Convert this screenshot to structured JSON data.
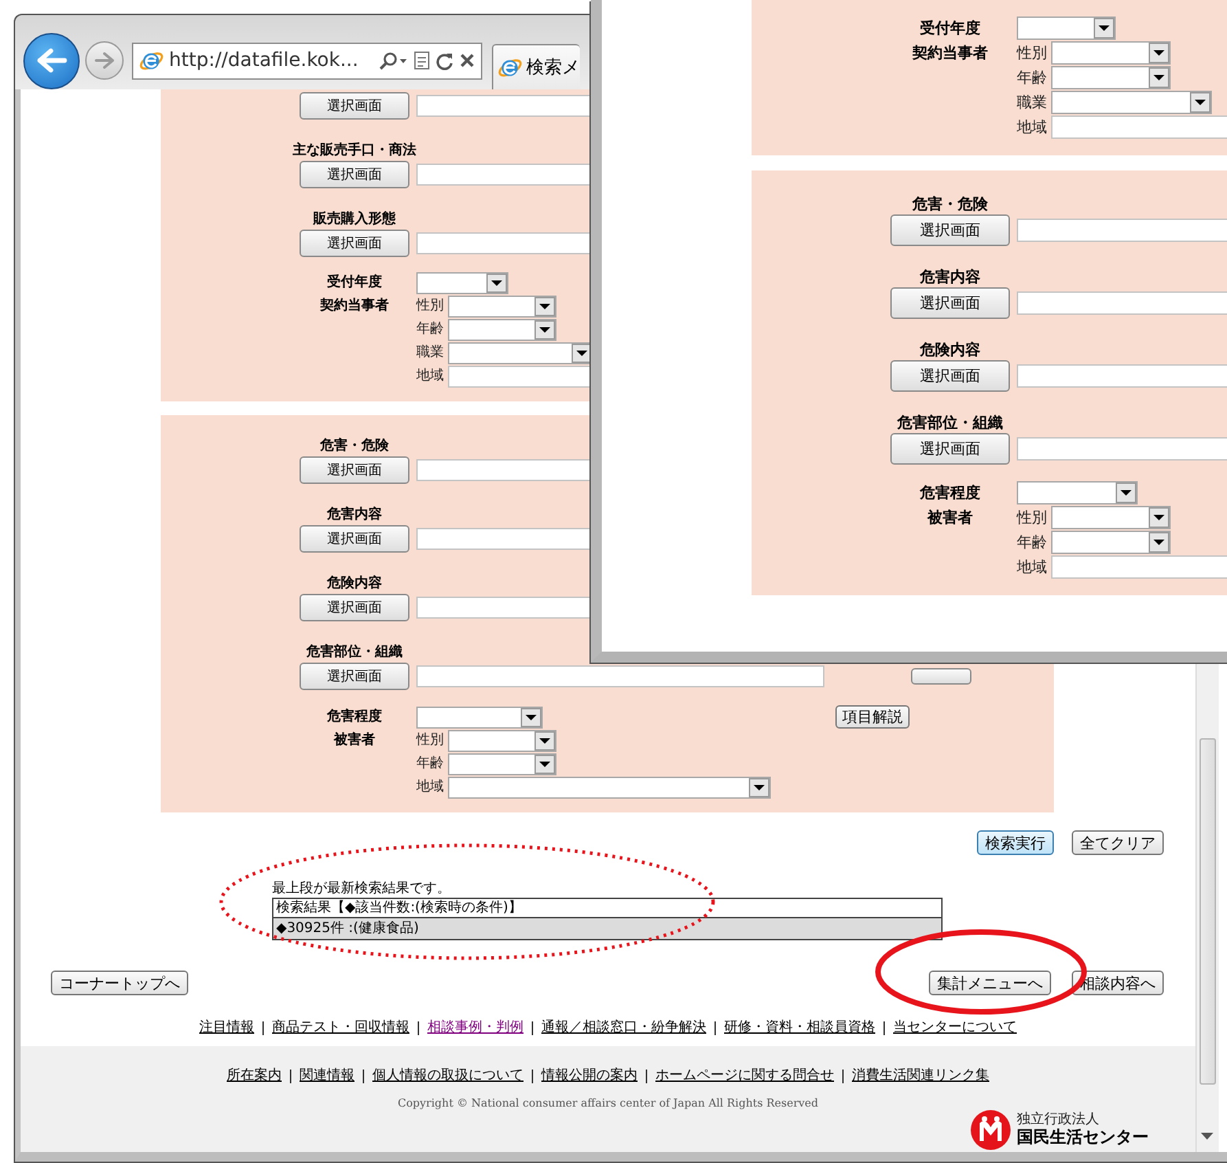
{
  "browser": {
    "address": "http://datafile.kok...",
    "tab_title": "検索メ"
  },
  "main_panels": [
    {
      "rows": [
        {
          "kind": "picker",
          "button": "選択画面"
        },
        {
          "kind": "picker",
          "label": "主な販売手口・商法",
          "button": "選択画面"
        },
        {
          "kind": "picker",
          "label": "販売購入形態",
          "button": "選択画面"
        },
        {
          "kind": "year",
          "label": "受付年度"
        },
        {
          "kind": "person",
          "label": "契約当事者",
          "fields": [
            {
              "label": "性別",
              "kind": "select"
            },
            {
              "label": "年齢",
              "kind": "select"
            },
            {
              "label": "職業",
              "kind": "wide-select"
            },
            {
              "label": "地域",
              "kind": "text"
            }
          ]
        }
      ]
    },
    {
      "rows": [
        {
          "kind": "picker",
          "label": "危害・危険",
          "button": "選択画面"
        },
        {
          "kind": "picker",
          "label": "危害内容",
          "button": "選択画面"
        },
        {
          "kind": "picker",
          "label": "危険内容",
          "button": "選択画面"
        },
        {
          "kind": "picker",
          "label": "危害部位・組織",
          "button": "選択画面",
          "side_button": true
        },
        {
          "kind": "year",
          "label": "危害程度",
          "help_button": "項目解説"
        },
        {
          "kind": "person",
          "label": "被害者",
          "fields": [
            {
              "label": "性別",
              "kind": "select"
            },
            {
              "label": "年齢",
              "kind": "select"
            },
            {
              "label": "地域",
              "kind": "long-select"
            }
          ]
        }
      ]
    }
  ],
  "search_buttons": [
    {
      "label": "検索実行",
      "focused": true
    },
    {
      "label": "全てクリア",
      "focused": false
    }
  ],
  "results": {
    "note": "最上段が最新検索結果です。",
    "header": "検索結果【◆該当件数:(検索時の条件)】",
    "rows": [
      "◆30925件 :(健康食品)"
    ]
  },
  "nav_buttons": [
    {
      "label": "コーナートップへ"
    },
    {
      "label": "集計メニューへ"
    },
    {
      "label": "相談内容へ"
    }
  ],
  "footer_nav": [
    {
      "label": "注目情報",
      "visited": false
    },
    {
      "label": "商品テスト・回収情報",
      "visited": false
    },
    {
      "label": "相談事例・判例",
      "visited": true
    },
    {
      "label": "通報／相談窓口・紛争解決",
      "visited": false
    },
    {
      "label": "研修・資料・相談員資格",
      "visited": false
    },
    {
      "label": "当センターについて",
      "visited": false
    }
  ],
  "footer_links": [
    "所在案内",
    "関連情報",
    "個人情報の取扱について",
    "情報公開の案内",
    "ホームページに関する問合せ",
    "消費生活関連リンク集"
  ],
  "copyright": "Copyright © National consumer affairs center of Japan All Rights Reserved",
  "logo": {
    "org_type": "独立行政法人",
    "name": "国民生活センター"
  },
  "front_window": {
    "panels": [
      {
        "rows": [
          {
            "kind": "year",
            "label": "受付年度"
          },
          {
            "kind": "person",
            "label": "契約当事者",
            "fields": [
              {
                "label": "性別",
                "kind": "select"
              },
              {
                "label": "年齢",
                "kind": "select"
              },
              {
                "label": "職業",
                "kind": "wide-select"
              },
              {
                "label": "地域",
                "kind": "text"
              }
            ]
          }
        ]
      },
      {
        "rows": [
          {
            "kind": "picker",
            "label": "危害・危険",
            "button": "選択画面"
          },
          {
            "kind": "picker",
            "label": "危害内容",
            "button": "選択画面"
          },
          {
            "kind": "picker",
            "label": "危険内容",
            "button": "選択画面"
          },
          {
            "kind": "picker",
            "label": "危害部位・組織",
            "button": "選択画面"
          },
          {
            "kind": "year",
            "label": "危害程度"
          },
          {
            "kind": "person",
            "label": "被害者",
            "fields": [
              {
                "label": "性別",
                "kind": "select"
              },
              {
                "label": "年齢",
                "kind": "select"
              },
              {
                "label": "地域",
                "kind": "text"
              }
            ]
          }
        ]
      }
    ]
  },
  "annotations": [
    {
      "kind": "dotted"
    },
    {
      "kind": "solid"
    }
  ]
}
